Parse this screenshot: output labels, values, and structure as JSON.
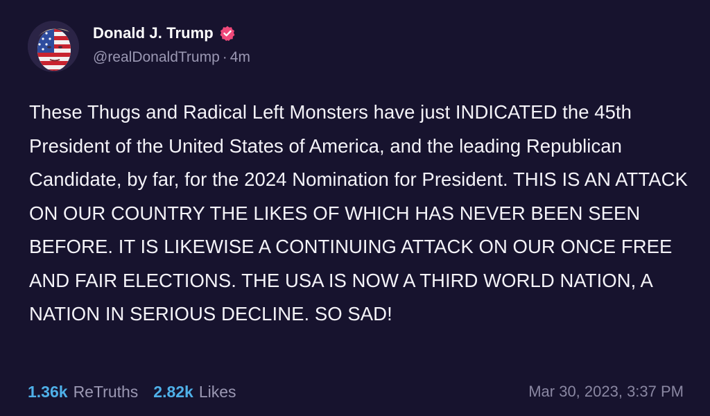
{
  "post": {
    "author": {
      "display_name": "Donald J. Trump",
      "handle": "@realDonaldTrump",
      "age": "4m",
      "verified": true,
      "avatar_icon": "avatar-flag-face-icon",
      "verified_icon": "verified-badge-icon"
    },
    "text": "These Thugs and Radical Left Monsters have just INDICATED the 45th President of the United States of America, and the leading Republican Candidate, by far, for the 2024 Nomination for President. THIS IS AN ATTACK ON OUR COUNTRY THE LIKES OF WHICH HAS NEVER BEEN SEEN BEFORE. IT IS LIKEWISE A CONTINUING ATTACK ON OUR ONCE FREE AND FAIR ELECTIONS. THE USA IS NOW A THIRD WORLD NATION, A NATION IN SERIOUS DECLINE. SO SAD!",
    "stats": {
      "retruths_count": "1.36k",
      "retruths_label": "ReTruths",
      "likes_count": "2.82k",
      "likes_label": "Likes"
    },
    "timestamp": "Mar 30, 2023, 3:37 PM"
  },
  "colors": {
    "background": "#17132e",
    "accent": "#4fb0e8",
    "muted": "#9b98b3",
    "verified": "#f0497a"
  }
}
